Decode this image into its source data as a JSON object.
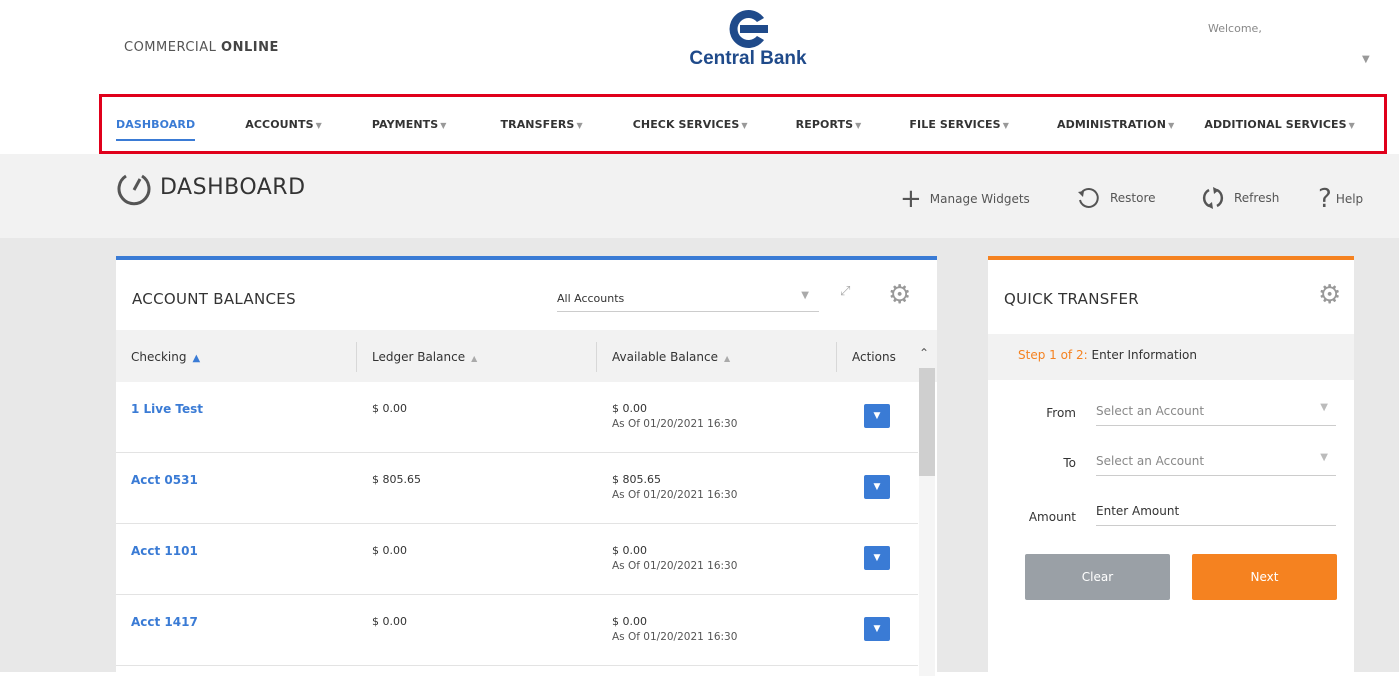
{
  "header": {
    "brand_light": "COMMERCIAL ",
    "brand_bold": "ONLINE",
    "logo_text": "Central Bank",
    "welcome": "Welcome,",
    "logo_color": "#1f4a8a"
  },
  "nav": {
    "items": [
      {
        "label": "DASHBOARD",
        "active": true
      },
      {
        "label": "ACCOUNTS",
        "dropdown": true
      },
      {
        "label": "PAYMENTS",
        "dropdown": true
      },
      {
        "label": "TRANSFERS",
        "dropdown": true
      },
      {
        "label": "CHECK SERVICES",
        "dropdown": true
      },
      {
        "label": "REPORTS",
        "dropdown": true
      },
      {
        "label": "FILE SERVICES",
        "dropdown": true
      },
      {
        "label": "ADMINISTRATION",
        "dropdown": true
      },
      {
        "label": "ADDITIONAL SERVICES",
        "dropdown": true
      }
    ],
    "highlight_color": "#e0001b"
  },
  "dashboard": {
    "title": "DASHBOARD",
    "tools": {
      "manage_widgets": "Manage Widgets",
      "restore": "Restore",
      "refresh": "Refresh",
      "help": "Help"
    }
  },
  "account_balances": {
    "title": "ACCOUNT BALANCES",
    "filter_value": "All Accounts",
    "columns": {
      "checking": "Checking",
      "ledger": "Ledger Balance",
      "available": "Available Balance",
      "actions": "Actions"
    },
    "rows": [
      {
        "name": "1 Live Test",
        "ledger": "$ 0.00",
        "available": "$ 0.00",
        "as_of": "As Of 01/20/2021 16:30"
      },
      {
        "name": "Acct 0531",
        "ledger": "$ 805.65",
        "available": "$ 805.65",
        "as_of": "As Of 01/20/2021 16:30"
      },
      {
        "name": "Acct 1101",
        "ledger": "$ 0.00",
        "available": "$ 0.00",
        "as_of": "As Of 01/20/2021 16:30"
      },
      {
        "name": "Acct 1417",
        "ledger": "$ 0.00",
        "available": "$ 0.00",
        "as_of": "As Of 01/20/2021 16:30"
      }
    ],
    "accent_color": "#3a7bd5"
  },
  "quick_transfer": {
    "title": "QUICK TRANSFER",
    "step_prefix": "Step 1 of 2:",
    "step_text": "Enter Information",
    "from_label": "From",
    "from_placeholder": "Select an Account",
    "to_label": "To",
    "to_placeholder": "Select an Account",
    "amount_label": "Amount",
    "amount_placeholder": "Enter Amount",
    "clear_label": "Clear",
    "next_label": "Next",
    "accent_color": "#f58220"
  }
}
